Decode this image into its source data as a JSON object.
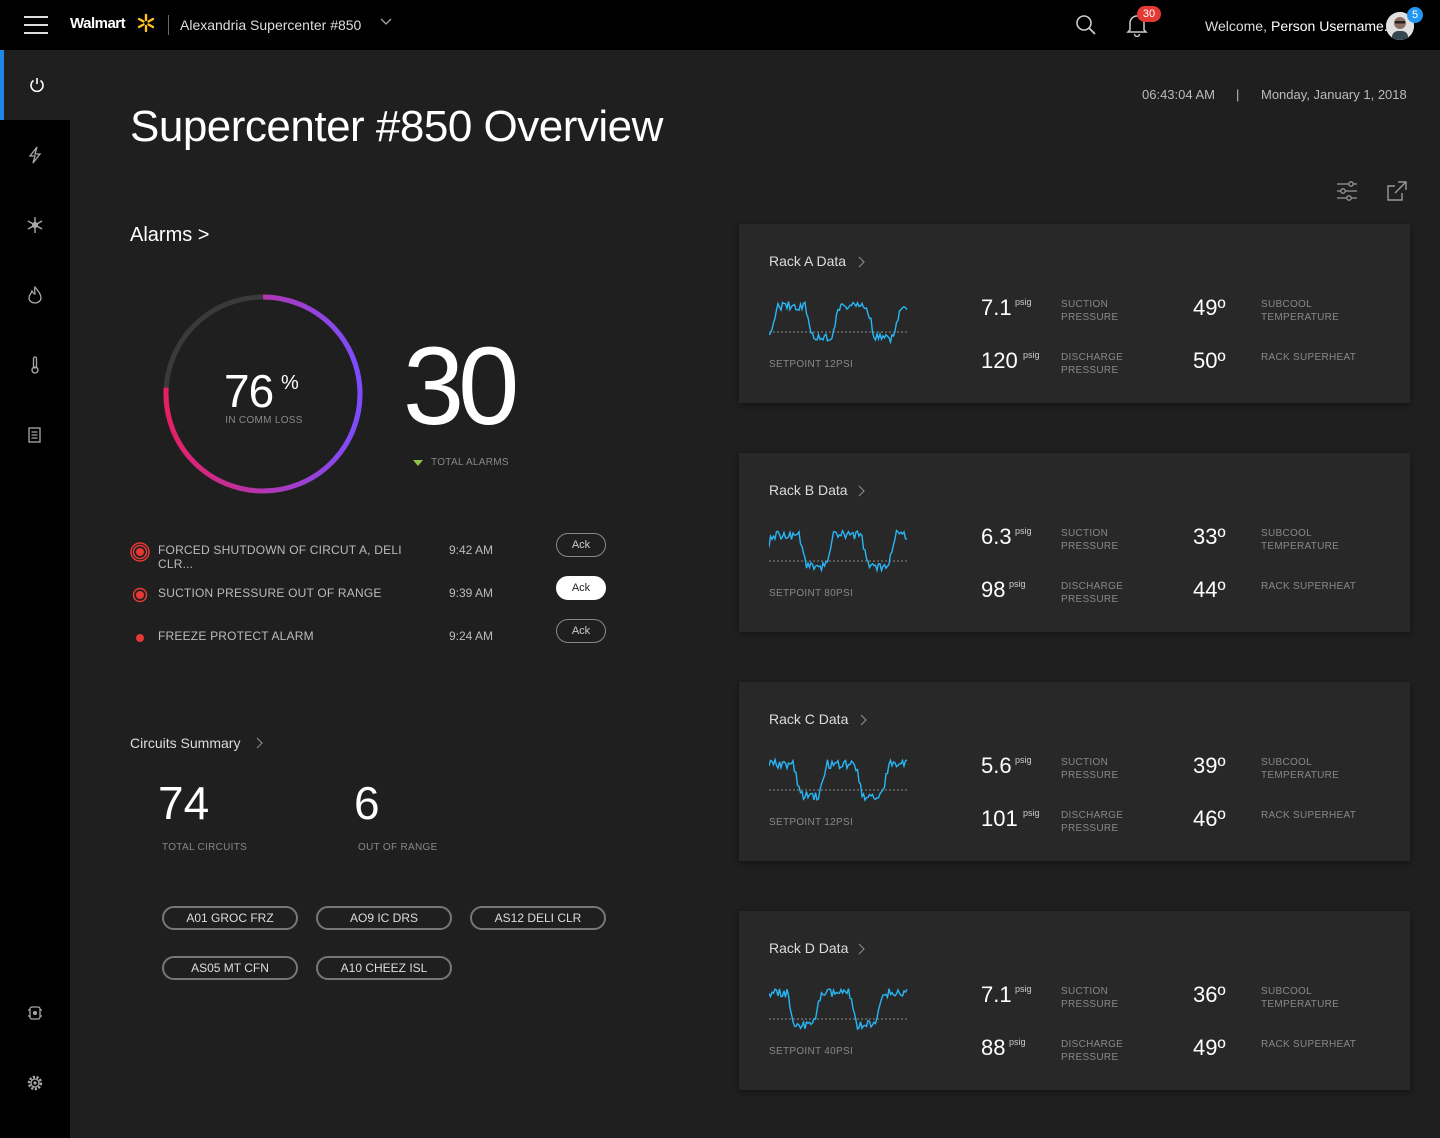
{
  "header": {
    "brand": "Walmart",
    "store_name": "Alexandria Supercenter #850",
    "notification_count": "30",
    "welcome_text": "Welcome,",
    "user_name": "Person Username.",
    "avatar_badge": "5"
  },
  "sidebar": {
    "items": [
      {
        "name": "overview",
        "icon": "power-icon",
        "active": true
      },
      {
        "name": "energy",
        "icon": "lightning-icon"
      },
      {
        "name": "refrigeration",
        "icon": "snowflake-icon"
      },
      {
        "name": "hvac",
        "icon": "flame-icon"
      },
      {
        "name": "temperature",
        "icon": "thermometer-icon"
      },
      {
        "name": "reports",
        "icon": "document-icon"
      }
    ],
    "bottom_items": [
      {
        "name": "tools",
        "icon": "gear-tool-icon"
      },
      {
        "name": "settings",
        "icon": "settings-icon"
      }
    ]
  },
  "main": {
    "time": "06:43:04 AM",
    "date_separator": "|",
    "date": "Monday, January 1, 2018",
    "title": "Supercenter #850 Overview"
  },
  "alarms": {
    "link_label": "Alarms >",
    "comm_loss_value": "76",
    "comm_loss_unit": "%",
    "comm_loss_fraction": 0.76,
    "comm_loss_label": "IN COMM LOSS",
    "total": "30",
    "total_label": "TOTAL ALARMS",
    "list": [
      {
        "text": "FORCED SHUTDOWN OF CIRCUT A, DELI CLR...",
        "time": "9:42 AM",
        "ack": "Ack"
      },
      {
        "text": "SUCTION PRESSURE OUT OF RANGE",
        "time": "9:39 AM",
        "ack": "Ack"
      },
      {
        "text": "FREEZE PROTECT ALARM",
        "time": "9:24 AM",
        "ack": "Ack"
      }
    ]
  },
  "circuits": {
    "link_label": "Circuits Summary",
    "total": "74",
    "total_label": "TOTAL CIRCUITS",
    "out_of_range": "6",
    "out_of_range_label": "OUT OF RANGE",
    "chips": [
      "A01 GROC FRZ",
      "AO9 IC DRS",
      "AS12 DELI CLR",
      "AS05 MT CFN",
      "A10 CHEEZ ISL"
    ]
  },
  "racks": [
    {
      "title": "Rack A Data",
      "setpoint": "SETPOINT 12PSI",
      "suction": "7.1",
      "discharge": "120",
      "subcool": "49",
      "superheat": "50"
    },
    {
      "title": "Rack B Data",
      "setpoint": "SETPOINT 80PSI",
      "suction": "6.3",
      "discharge": "98",
      "subcool": "33",
      "superheat": "44"
    },
    {
      "title": "Rack C Data",
      "setpoint": "SETPOINT 12PSI",
      "suction": "5.6",
      "discharge": "101",
      "subcool": "39",
      "superheat": "46"
    },
    {
      "title": "Rack D Data",
      "setpoint": "SETPOINT 40PSI",
      "suction": "7.1",
      "discharge": "88",
      "subcool": "36",
      "superheat": "49"
    }
  ],
  "rack_labels": {
    "unit": "psig",
    "degree": "º",
    "suction_label": "SUCTION PRESSURE",
    "discharge_label": "DISCHARGE PRESSURE",
    "subcool_label": "SUBCOOL TEMPERATURE",
    "superheat_label": "RACK SUPERHEAT"
  },
  "colors": {
    "accent_blue": "#1e88e5",
    "alarm_red": "#e53935",
    "gauge_start": "#e91e63",
    "gauge_end": "#7c4dff",
    "spark": "#29b6f6",
    "trend_green": "#8bc34a"
  }
}
